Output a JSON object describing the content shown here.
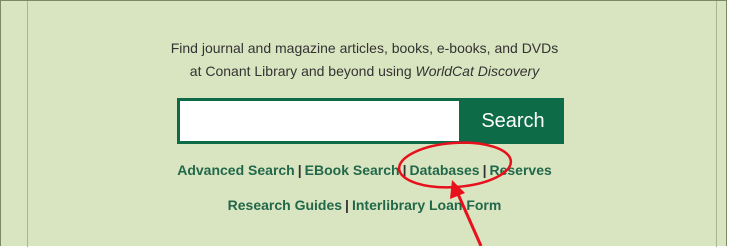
{
  "intro": {
    "line1": "Find journal and magazine articles, books, e-books, and DVDs",
    "line2_prefix": "at Conant Library and beyond using ",
    "line2_emphasis": "WorldCat Discovery"
  },
  "search": {
    "value": "",
    "placeholder": "",
    "button_label": "Search"
  },
  "links": {
    "row1": [
      "Advanced Search",
      "EBook Search",
      "Databases",
      "Reserves"
    ],
    "row2": [
      "Research Guides",
      "Interlibrary Loan Form"
    ],
    "separator": "|"
  },
  "colors": {
    "panel_background": "#d9e4c0",
    "brand_green": "#0d6b47",
    "link_green": "#21684a",
    "annotation_red": "#e8101c"
  }
}
